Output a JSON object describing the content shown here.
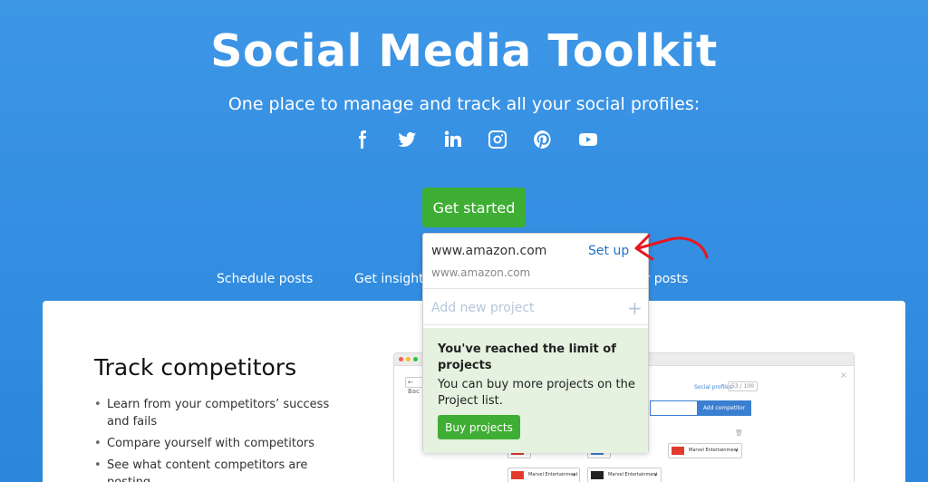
{
  "hero": {
    "title": "Social Media Toolkit",
    "subtitle": "One place to manage and track all your social profiles:",
    "social_icons": [
      "facebook-icon",
      "twitter-icon",
      "linkedin-icon",
      "instagram-icon",
      "pinterest-icon",
      "youtube-icon"
    ],
    "cta_label": "Get started"
  },
  "tabs": [
    {
      "label": "Schedule posts"
    },
    {
      "label": "Get insight"
    },
    {
      "label": "ost your posts"
    }
  ],
  "feature": {
    "title": "Track competitors",
    "bullets": [
      "Learn from your competitors’ success and fails",
      "Compare yourself with competitors",
      "See what content competitors are posting"
    ]
  },
  "dropdown": {
    "project_domain": "www.amazon.com",
    "setup_label": "Set up",
    "project_subdomain": "www.amazon.com",
    "add_placeholder": "Add new project",
    "add_icon": "+",
    "limit_title": "You've reached the limit of projects",
    "limit_text": "You can buy more projects on the Project list.",
    "buy_label": "Buy projects"
  },
  "mock": {
    "back_label": "← Bac",
    "social_profiles_label": "Social profiles",
    "social_profiles_count": "53 / 100",
    "add_competitor_label": "Add competitor",
    "chip_label": "Marvel Entertainment",
    "close_glyph": "×",
    "trash_glyph": "🗑"
  },
  "colors": {
    "background": "#2f8ae0",
    "accent_green": "#3fae34",
    "link_blue": "#2272c5",
    "limit_bg": "#e4f2df",
    "annotation_red": "#e8161f"
  }
}
